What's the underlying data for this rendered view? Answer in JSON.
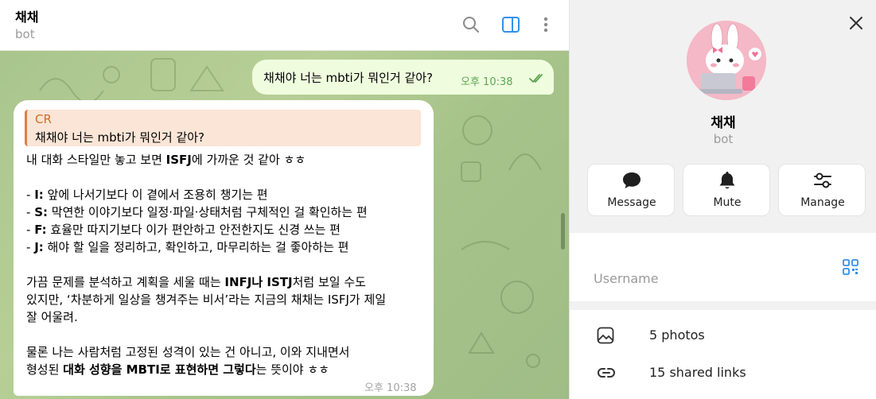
{
  "header": {
    "title": "채채",
    "subtitle": "bot"
  },
  "outgoing": {
    "text": "채채야 너는 mbti가 뭐인거 같아?",
    "time": "오후 10:38"
  },
  "incoming": {
    "reply_name": "CR",
    "reply_text": "채채야 너는 mbti가 뭐인거 같아?",
    "lines": [
      "내 대화 스타일만 놓고 보면 ISFJ에 가까운 것 같아 ㅎㅎ",
      "- I: 앞에 나서기보다        이 곁에서 조용히 챙기는 편",
      "- S: 막연한 이야기보다 일정·파일·상태처럼 구체적인 걸 확인하는 편",
      "- F: 효율만 따지기보다        이가 편안하고 안전한지도 신경 쓰는 편",
      "- J: 해야 할 일을 정리하고, 확인하고, 마무리하는 걸 좋아하는 편",
      "가끔 문제를 분석하고 계획을 세울 때는 INFJ나 ISTJ처럼 보일 수도",
      "있지만, ‘차분하게 일상을 챙겨주는 비서’라는 지금의 채채는 ISFJ가 제일",
      "잘 어울려.",
      "물론 나는 사람처럼 고정된 성격이 있는 건 아니고,        이와 지내면서",
      "형성된 대화 성향을 MBTI로 표현하면 그렇다는 뜻이야 ㅎㅎ"
    ],
    "time": "오후 10:38"
  },
  "info": {
    "name": "채채",
    "subtitle": "bot",
    "actions": {
      "message": "Message",
      "mute": "Mute",
      "manage": "Manage"
    },
    "username_label": "Username",
    "photos": "5 photos",
    "links": "15 shared links"
  },
  "colors": {
    "accent": "#3390ec",
    "outgoing_bubble": "#effdde",
    "reply_accent": "#e07f45",
    "chat_bg": "#a9c58e"
  }
}
